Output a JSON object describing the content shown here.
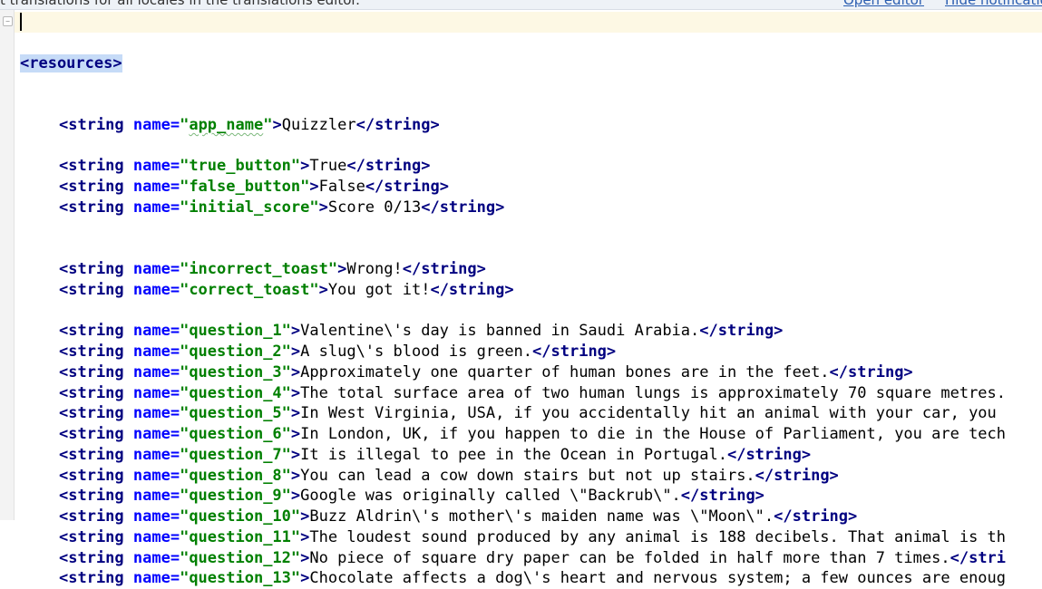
{
  "banner": {
    "text": "t translations for all locales in the translations editor.",
    "link_open_editor": "Open editor",
    "link_hide": "Hide notification"
  },
  "editor": {
    "root_open": "<resources>",
    "strings": [
      {
        "name": "app_name",
        "value": "Quizzler",
        "blank_after": 1
      },
      {
        "name": "true_button",
        "value": "True",
        "blank_after": 0
      },
      {
        "name": "false_button",
        "value": "False",
        "blank_after": 0
      },
      {
        "name": "initial_score",
        "value": "Score 0/13",
        "blank_after": 2
      },
      {
        "name": "incorrect_toast",
        "value": "Wrong!",
        "blank_after": 0
      },
      {
        "name": "correct_toast",
        "value": "You got it!",
        "blank_after": 1
      },
      {
        "name": "question_1",
        "value": "Valentine\\'s day is banned in Saudi Arabia.",
        "blank_after": 0
      },
      {
        "name": "question_2",
        "value": "A slug\\'s blood is green.",
        "blank_after": 0
      },
      {
        "name": "question_3",
        "value": "Approximately one quarter of human bones are in the feet.",
        "blank_after": 0
      },
      {
        "name": "question_4",
        "value": "The total surface area of two human lungs is approximately 70 square metres.",
        "blank_after": 0
      },
      {
        "name": "question_5",
        "value": "In West Virginia, USA, if you accidentally hit an animal with your car, you",
        "blank_after": 0
      },
      {
        "name": "question_6",
        "value": "In London, UK, if you happen to die in the House of Parliament, you are tech",
        "blank_after": 0
      },
      {
        "name": "question_7",
        "value": "It is illegal to pee in the Ocean in Portugal.",
        "blank_after": 0
      },
      {
        "name": "question_8",
        "value": "You can lead a cow down stairs but not up stairs.",
        "blank_after": 0
      },
      {
        "name": "question_9",
        "value": "Google was originally called \\\"Backrub\\\".",
        "blank_after": 0
      },
      {
        "name": "question_10",
        "value": "Buzz Aldrin\\'s mother\\'s maiden name was \\\"Moon\\\".",
        "blank_after": 0
      },
      {
        "name": "question_11",
        "value": "The loudest sound produced by any animal is 188 decibels. That animal is th",
        "blank_after": 0
      },
      {
        "name": "question_12",
        "value": "No piece of square dry paper can be folded in half more than 7 times.",
        "blank_after": 0
      },
      {
        "name": "question_13",
        "value": "Chocolate affects a dog\\'s heart and nervous system; a few ounces are enoug",
        "blank_after": 0
      }
    ],
    "truncated_closings": {
      "question_4": true,
      "question_5": true,
      "question_6": true,
      "question_11": true,
      "question_12": true,
      "question_13": true
    },
    "question_12_close_partial": "</stri",
    "syntax_colors": {
      "tag": "#000080",
      "attribute": "#0000ff",
      "value": "#008000",
      "text": "#000000",
      "current_line": "#fdf8e4",
      "tag_highlight": "#c6dbf7"
    }
  }
}
